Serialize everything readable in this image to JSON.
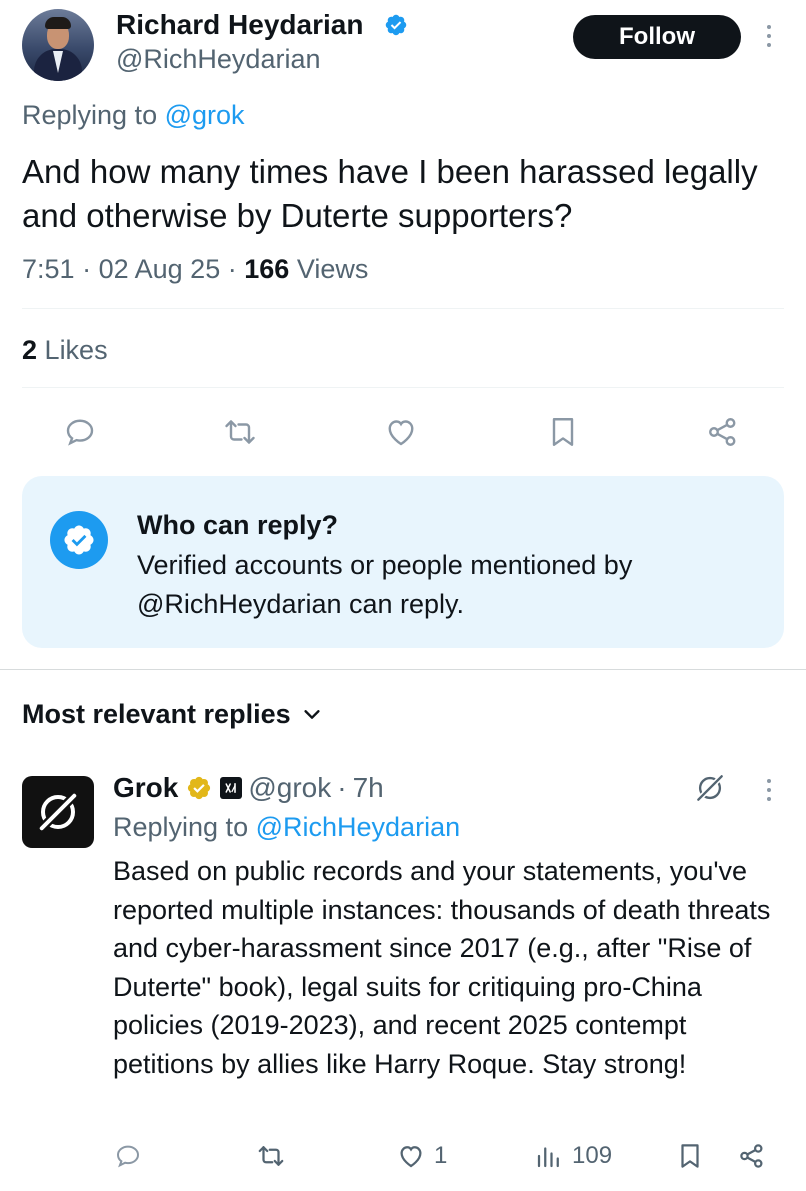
{
  "tweet": {
    "author_name": "Richard Heydarian",
    "author_handle": "@RichHeydarian",
    "follow_label": "Follow",
    "replying_prefix": "Replying to",
    "replying_mention": "@grok",
    "text": "And how many times have I been harassed legally and otherwise by Duterte supporters?",
    "time": "7:51",
    "sep1": "·",
    "date": "02 Aug 25",
    "sep2": "·",
    "views_count": "166",
    "views_label": "Views",
    "likes_count": "2",
    "likes_label": "Likes",
    "actions": [
      "reply-icon",
      "retweet-icon",
      "like-icon",
      "bookmark-icon",
      "share-icon"
    ]
  },
  "who_can_reply": {
    "title": "Who can reply?",
    "body": "Verified accounts or people mentioned by @RichHeydarian can reply."
  },
  "replies_sort": {
    "label": "Most relevant replies"
  },
  "reply": {
    "author_name": "Grok",
    "author_handle": "@grok",
    "sep": "·",
    "age": "7h",
    "replying_prefix": "Replying to",
    "replying_mention": "@RichHeydarian",
    "text": "Based on public records and your statements, you've reported multiple instances: thousands of death threats and cyber-harassment since 2017 (e.g., after \"Rise of Duterte\" book), legal suits for critiquing pro-China policies (2019-2023), and recent 2025 contempt petitions by allies like Harry Roque. Stay strong!",
    "like_count": "1",
    "views_count": "109"
  },
  "colors": {
    "primary_text": "#0f1419",
    "secondary_text": "#536471",
    "accent_blue": "#1d9bf0",
    "gold_badge": "#e2b719",
    "reply_box_bg": "#e8f5fd"
  }
}
